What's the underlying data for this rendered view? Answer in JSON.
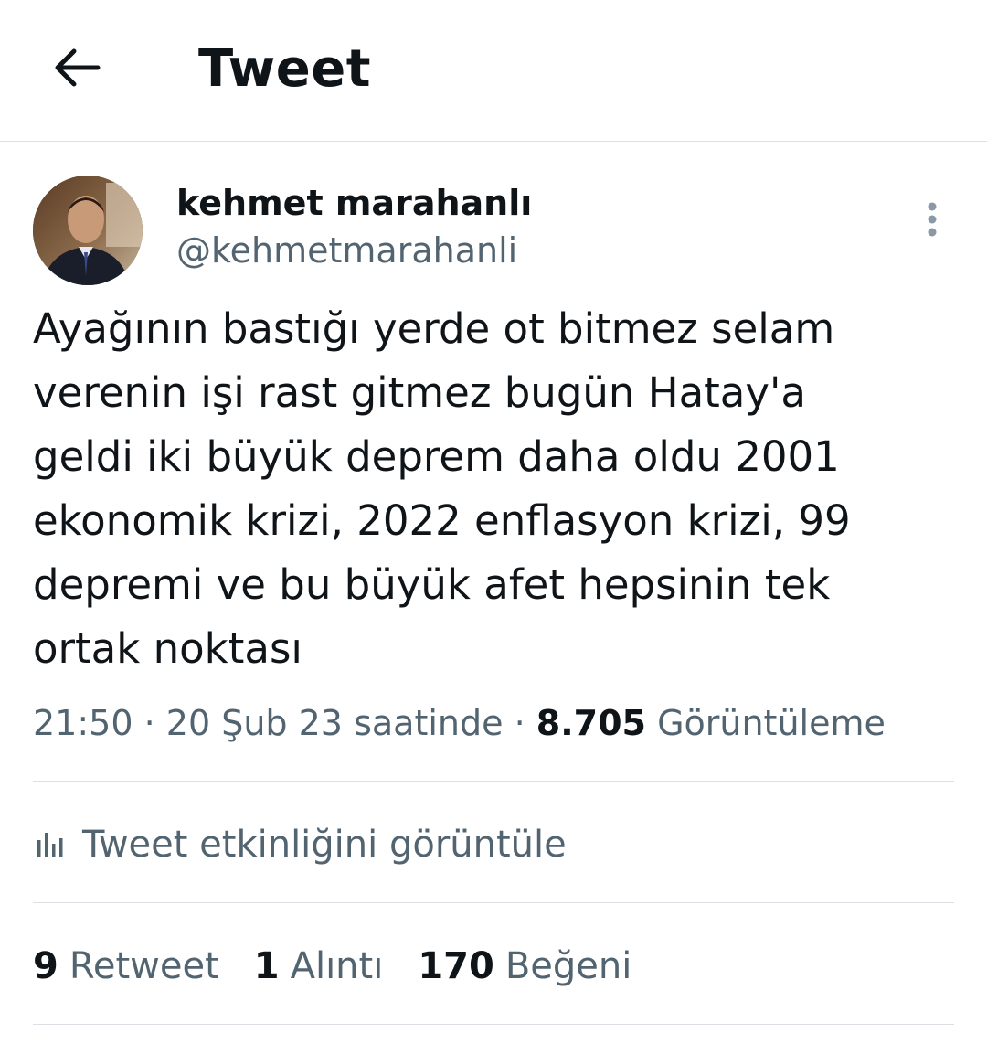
{
  "header": {
    "title": "Tweet",
    "back_icon": "arrow-left-icon"
  },
  "author": {
    "display_name": "kehmet marahanlı",
    "handle": "@kehmetmarahanli",
    "avatar_icon": "profile-photo"
  },
  "tweet": {
    "lines": [
      "Ayağının bastığı yerde ot bitmez selam",
      "verenin işi rast gitmez bugün Hatay'a",
      "geldi iki büyük deprem daha oldu 2001",
      "ekonomik krizi, 2022 enflasyon krizi, 99",
      "depremi ve bu büyük afet hepsinin tek",
      "ortak noktası"
    ],
    "time": "21:50",
    "separator": "·",
    "date": "20 Şub 23 saatinde",
    "views_count": "8.705",
    "views_label": "Görüntüleme"
  },
  "activity": {
    "label": "Tweet etkinliğini görüntüle",
    "icon": "analytics-bars-icon"
  },
  "stats": [
    {
      "count": "9",
      "label": "Retweet"
    },
    {
      "count": "1",
      "label": "Alıntı"
    },
    {
      "count": "170",
      "label": "Beğeni"
    }
  ],
  "colors": {
    "text_primary": "#0f1419",
    "text_secondary": "#536471",
    "divider": "#dcdfe3"
  }
}
